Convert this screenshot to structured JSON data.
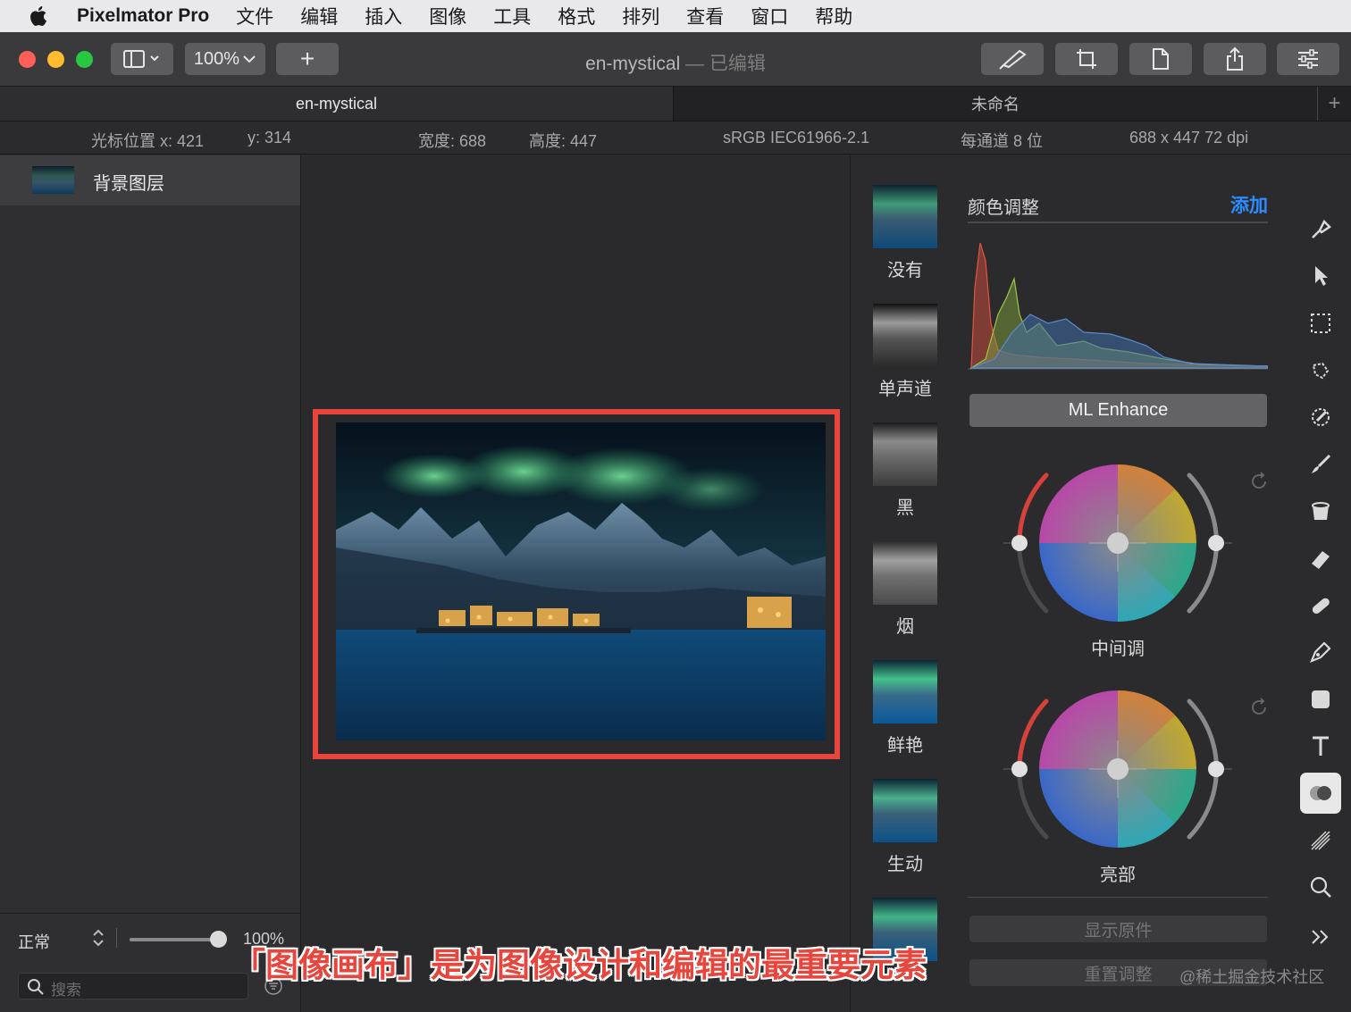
{
  "menubar": {
    "app_name": "Pixelmator Pro",
    "items": [
      "文件",
      "编辑",
      "插入",
      "图像",
      "工具",
      "格式",
      "排列",
      "查看",
      "窗口",
      "帮助"
    ]
  },
  "toolbar": {
    "zoom": "100%",
    "add_label": "+",
    "doc_title": "en-mystical",
    "dash": " — ",
    "edited": "已编辑"
  },
  "tabs": [
    {
      "label": "en-mystical",
      "active": true
    },
    {
      "label": "未命名",
      "active": false
    }
  ],
  "tab_add_label": "+",
  "infobar": {
    "cursor_x": "光标位置 x:  421",
    "cursor_y": "y:  314",
    "width": "宽度:  688",
    "height": "高度:  447",
    "color_profile": "sRGB IEC61966-2.1",
    "bit_depth": "每通道 8 位",
    "size_dpi": "688 x 447 72 dpi"
  },
  "layers": {
    "items": [
      {
        "name": "背景图层"
      }
    ],
    "blend_mode": "正常",
    "opacity_value": 1.0,
    "opacity_label": "100%",
    "search_placeholder": "搜索"
  },
  "presets": [
    {
      "label": "没有",
      "style": "color"
    },
    {
      "label": "单声道",
      "style": "mono"
    },
    {
      "label": "黑",
      "style": "mono"
    },
    {
      "label": "烟",
      "style": "mono"
    },
    {
      "label": "鲜艳",
      "style": "color"
    },
    {
      "label": "生动",
      "style": "color"
    },
    {
      "label": "",
      "style": "color"
    }
  ],
  "adjustments": {
    "title": "颜色调整",
    "add_label": "添加",
    "ml_enhance": "ML Enhance",
    "wheels": [
      {
        "label": "中间调"
      },
      {
        "label": "亮部"
      }
    ],
    "show_original": "显示原件",
    "reset": "重置调整"
  },
  "tools": [
    {
      "icon": "style-picker-icon"
    },
    {
      "icon": "arrange-pointer-icon"
    },
    {
      "icon": "rectangle-select-icon"
    },
    {
      "icon": "quick-select-icon"
    },
    {
      "icon": "color-picker-icon"
    },
    {
      "icon": "paint-brush-icon"
    },
    {
      "icon": "paint-bucket-icon"
    },
    {
      "icon": "erase-icon"
    },
    {
      "icon": "retouch-icon"
    },
    {
      "icon": "pen-icon"
    },
    {
      "icon": "shape-icon"
    },
    {
      "icon": "type-icon"
    },
    {
      "icon": "color-adjust-icon",
      "active": true
    },
    {
      "icon": "effects-icon"
    },
    {
      "icon": "zoom-icon"
    },
    {
      "icon": "more-tools-icon"
    }
  ],
  "colors": {
    "highlight": "#e8453c",
    "accent": "#2d8cff",
    "traffic_red": "#fe5f57",
    "traffic_yellow": "#febc2e",
    "traffic_green": "#28c840"
  },
  "caption": "「图像画布」是为图像设计和编辑的最重要元素",
  "watermark": "@稀土掘金技术社区"
}
